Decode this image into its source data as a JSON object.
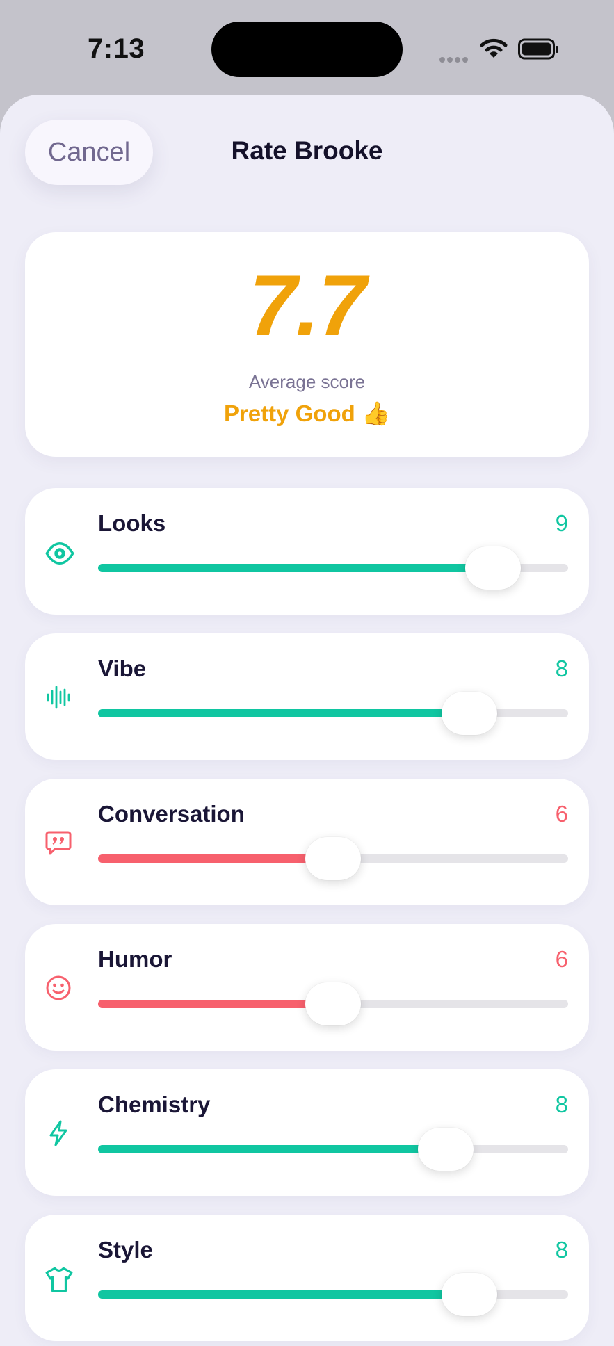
{
  "status_bar": {
    "time": "7:13"
  },
  "header": {
    "cancel_label": "Cancel",
    "title": "Rate Brooke"
  },
  "summary": {
    "score": "7.7",
    "caption": "Average score",
    "verdict": "Pretty Good 👍"
  },
  "colors": {
    "positive": "#10c6a1",
    "negative": "#f7606d",
    "accent": "#f0a20a"
  },
  "ratings": [
    {
      "label": "Looks",
      "value": "9",
      "fraction": 0.84,
      "tone": "positive",
      "icon": "eye-icon"
    },
    {
      "label": "Vibe",
      "value": "8",
      "fraction": 0.79,
      "tone": "positive",
      "icon": "waveform-icon"
    },
    {
      "label": "Conversation",
      "value": "6",
      "fraction": 0.5,
      "tone": "negative",
      "icon": "quote-bubble-icon"
    },
    {
      "label": "Humor",
      "value": "6",
      "fraction": 0.5,
      "tone": "negative",
      "icon": "smiley-icon"
    },
    {
      "label": "Chemistry",
      "value": "8",
      "fraction": 0.74,
      "tone": "positive",
      "icon": "bolt-icon"
    },
    {
      "label": "Style",
      "value": "8",
      "fraction": 0.79,
      "tone": "positive",
      "icon": "tshirt-icon"
    }
  ]
}
